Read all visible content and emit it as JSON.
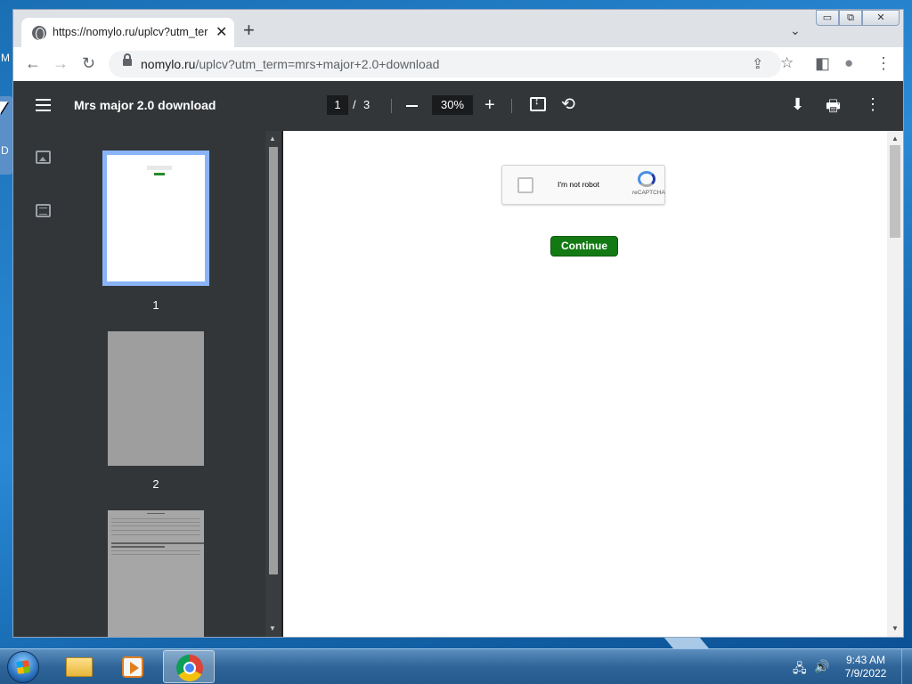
{
  "desktop": {
    "edge_letters": [
      "M",
      "D"
    ]
  },
  "browser": {
    "tab": {
      "title": "https://nomylo.ru/uplcv?utm_ter",
      "close": "✕"
    },
    "new_tab": "+",
    "tab_search": "⌄",
    "window_controls": {
      "minimize": "▭",
      "maximize": "⧉",
      "close": "✕"
    },
    "nav": {
      "back": "←",
      "forward": "→",
      "reload": "↻"
    },
    "address": {
      "host": "nomylo.ru",
      "path": "/uplcv?utm_term=mrs+major+2.0+download"
    },
    "omnibox_icons": {
      "share": "⇪",
      "bookmark": "☆"
    },
    "toolbar_icons": {
      "side_panel": "◧",
      "profile": "●",
      "menu": "⋮"
    }
  },
  "pdf": {
    "title": "Mrs major 2.0 download",
    "current_page": "1",
    "page_separator": "/",
    "total_pages": "3",
    "zoom": "30%",
    "zoom_in": "+",
    "icons": {
      "rotate": "⟲",
      "download": "⬇",
      "print": "🖶",
      "more": "⋮"
    },
    "thumbnails": [
      {
        "label": "1"
      },
      {
        "label": "2"
      }
    ],
    "content": {
      "captcha_label": "I'm not robot",
      "captcha_brand": "reCAPTCHA",
      "continue_button": "Continue"
    }
  },
  "taskbar": {
    "tray": {
      "network": "🖧",
      "volume": "🔊"
    },
    "clock": {
      "time": "9:43 AM",
      "date": "7/9/2022"
    }
  }
}
